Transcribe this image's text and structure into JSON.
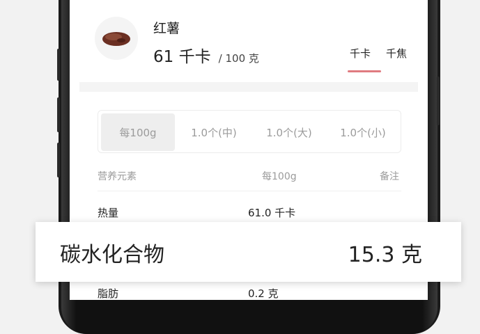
{
  "food": {
    "name": "红薯",
    "energy_value": "61 千卡",
    "energy_per": "/ 100 克",
    "unit_tabs": [
      "千卡",
      "千焦"
    ],
    "selected_unit": "千卡"
  },
  "portions": [
    "每100g",
    "1.0个(中)",
    "1.0个(大)",
    "1.0个(小)"
  ],
  "selected_portion": "每100g",
  "table": {
    "headers": [
      "营养元素",
      "每100g",
      "备注"
    ],
    "rows": [
      {
        "label": "热量",
        "value": "61.0 千卡"
      },
      {
        "label": "脂肪",
        "value": "0.2 克"
      }
    ]
  },
  "highlight": {
    "label": "碳水化合物",
    "value": "15.3 克"
  },
  "colors": {
    "accent": "#e07b80",
    "segment_active": "#eeeeee",
    "muted_text": "#9b9b9b"
  }
}
